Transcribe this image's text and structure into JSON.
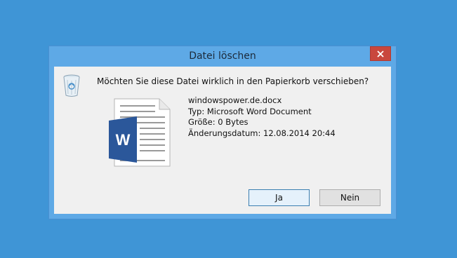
{
  "dialog": {
    "title": "Datei löschen",
    "close_icon": "close-icon",
    "question": "Möchten Sie diese Datei wirklich in den Papierkorb verschieben?",
    "file": {
      "name": "windowspower.de.docx",
      "type": "Typ: Microsoft Word Document",
      "size": "Größe: 0 Bytes",
      "modified": "Änderungsdatum: 12.08.2014 20:44",
      "icon": "word-document-icon",
      "icon_letter": "W"
    },
    "buttons": {
      "yes": "Ja",
      "no": "Nein"
    }
  },
  "colors": {
    "desktop": "#3f95d6",
    "titlebar": "#5ea9e6",
    "close": "#c9473d",
    "word_blue": "#2b579a"
  }
}
